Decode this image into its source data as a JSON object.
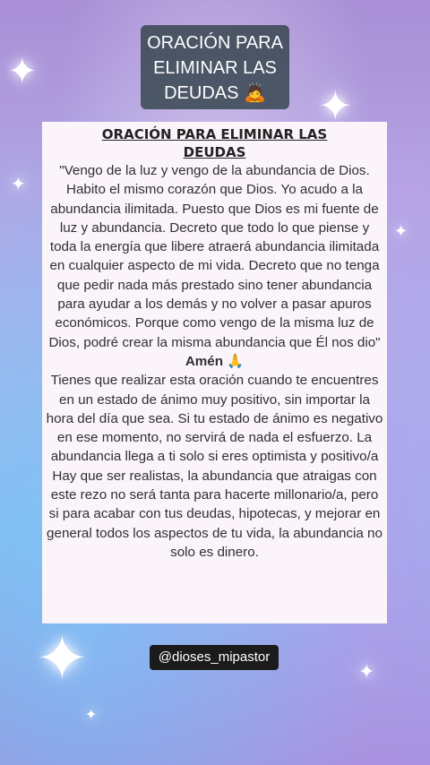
{
  "header": {
    "line1": "ORACIÓN PARA",
    "line2": "ELIMINAR LAS",
    "line3": "DEUDAS 🙇"
  },
  "card": {
    "title_line1": "ORACIÓN PARA ELIMINAR LAS",
    "title_line2": "DEUDAS",
    "prayer": "\"Vengo de la luz y vengo de la abundancia de Dios. Habito el mismo corazón que Dios. Yo acudo a la abundancia ilimitada. Puesto que Dios es mi fuente de luz y abundancia. Decreto que todo lo que piense y toda la energía que libere atraerá abundancia ilimitada en cualquier aspecto de mi vida. Decreto que no tenga que pedir nada más prestado sino tener abundancia para ayudar a los demás y no volver a pasar apuros económicos. Porque como vengo de la misma luz de Dios, podré crear la misma abundancia que Él nos dio\"",
    "amen": "Amén 🙏",
    "advice": "Tienes que realizar esta oración cuando te encuentres en un estado de ánimo muy positivo, sin importar la hora del día que sea. Si tu estado de ánimo es negativo en ese momento, no servirá de nada el esfuerzo. La abundancia llega a ti solo si eres optimista y positivo/a",
    "closing": "Hay que ser realistas, la abundancia que atraigas con este rezo no será tanta para hacerte millonario/a, pero si para acabar con tus deudas, hipotecas, y mejorar en general todos los aspectos de tu vida, la abundancia no solo es dinero."
  },
  "handle": "@dioses_mipastor"
}
